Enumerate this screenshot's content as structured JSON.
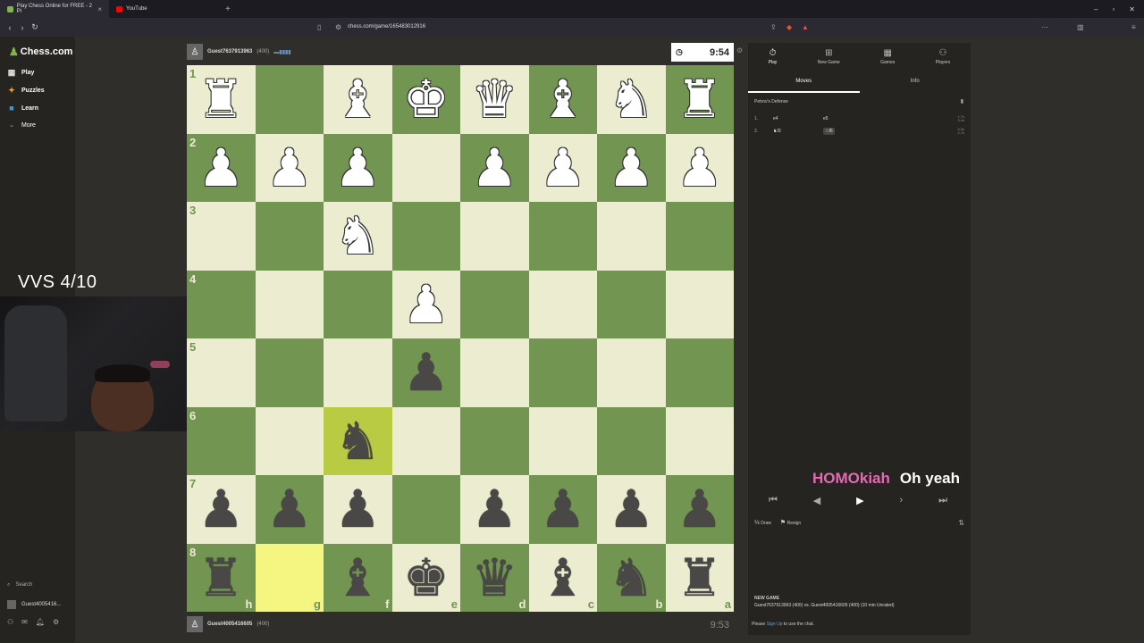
{
  "browser": {
    "tabs": [
      {
        "title": "Play Chess Online for FREE - 2 Pl",
        "favicon_color": "#81b64c"
      },
      {
        "title": "YouTube",
        "favicon_color": "#ff0000"
      }
    ],
    "url": "chess.com/game/165483012916"
  },
  "sidebar": {
    "logo": "Chess.com",
    "items": [
      {
        "label": "Play",
        "icon": "board-icon",
        "color": "#e0e0e0"
      },
      {
        "label": "Puzzles",
        "icon": "puzzle-icon",
        "color": "#f09d3a"
      },
      {
        "label": "Learn",
        "icon": "learn-icon",
        "color": "#3a9ad9"
      },
      {
        "label": "More",
        "icon": "chevron-down-icon",
        "color": "#aaaaaa"
      }
    ],
    "search_label": "Search",
    "user": "Guest4005416..."
  },
  "overlay": {
    "caption": "VVS 4/10",
    "chat_name": "HOMOkiah",
    "chat_msg": "Oh yeah"
  },
  "top_player": {
    "name": "Guest7637913963",
    "rating": "(400)",
    "clock": "9:54"
  },
  "bottom_player": {
    "name": "Guest4005416605",
    "rating": "(400)",
    "clock": "9:53"
  },
  "board": {
    "orientation": "black-bottom",
    "rank_labels": [
      "1",
      "2",
      "3",
      "4",
      "5",
      "6",
      "7",
      "8"
    ],
    "file_labels": [
      "h",
      "g",
      "f",
      "e",
      "d",
      "c",
      "b",
      "a"
    ],
    "rows": [
      [
        "wR",
        "",
        "wB",
        "wK",
        "wQ",
        "wB",
        "wN",
        "wR"
      ],
      [
        "wP",
        "wP",
        "wP",
        "",
        "wP",
        "wP",
        "wP",
        "wP"
      ],
      [
        "",
        "",
        "wN",
        "",
        "",
        "",
        "",
        ""
      ],
      [
        "",
        "",
        "",
        "wP",
        "",
        "",
        "",
        ""
      ],
      [
        "",
        "",
        "",
        "bP",
        "",
        "",
        "",
        ""
      ],
      [
        "",
        "",
        "bN",
        "",
        "",
        "",
        "",
        ""
      ],
      [
        "bP",
        "bP",
        "bP",
        "",
        "bP",
        "bP",
        "bP",
        "bP"
      ],
      [
        "bR",
        "",
        "bB",
        "bK",
        "bQ",
        "bB",
        "bN",
        "bR"
      ]
    ],
    "highlights": [
      [
        5,
        2
      ],
      [
        7,
        1
      ]
    ],
    "colors": {
      "light": "#ebecd0",
      "dark": "#739552",
      "hl_light": "#f5f682",
      "hl_dark": "#b9ca43"
    }
  },
  "panel": {
    "tabs": [
      {
        "label": "Play",
        "icon": "stopwatch-icon"
      },
      {
        "label": "New Game",
        "icon": "plus-icon"
      },
      {
        "label": "Games",
        "icon": "games-icon"
      },
      {
        "label": "Players",
        "icon": "players-icon"
      }
    ],
    "subtabs": [
      "Moves",
      "Info"
    ],
    "opening": "Petrov's Defense",
    "moves": [
      {
        "num": "1.",
        "white": "e4",
        "black": "e5",
        "white_time": "1.7s",
        "black_time": "3.4s"
      },
      {
        "num": "2.",
        "white": "♞f3",
        "black": "♘f6",
        "white_time": "0.5s",
        "black_time": "2.7s"
      }
    ],
    "actions": {
      "draw": "Draw",
      "resign": "Resign"
    },
    "new_game_heading": "NEW GAME",
    "new_game_line": "Guest7637913963 (400) vs. Guest4005416605 (400) (10 min Unrated)",
    "chat_prompt_before": "Please",
    "chat_prompt_link": "Sign Up",
    "chat_prompt_after": "to use the chat."
  }
}
